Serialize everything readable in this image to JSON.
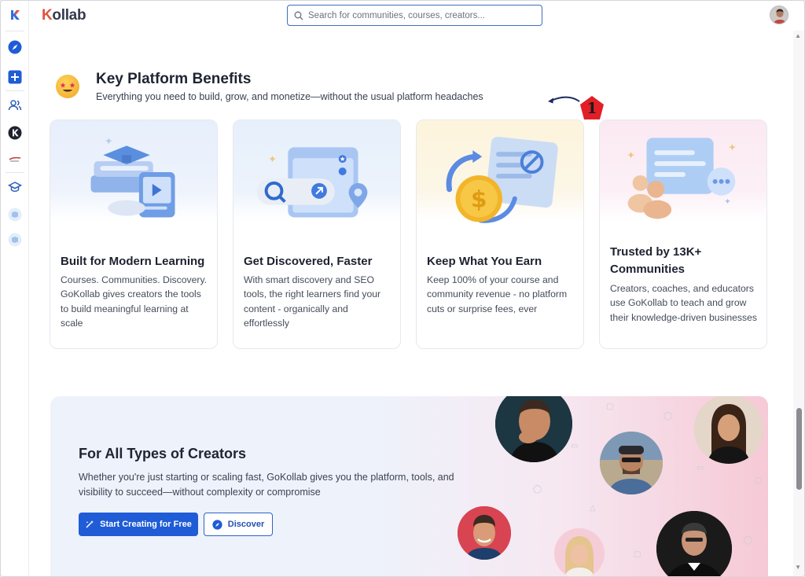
{
  "app": {
    "logo_text": "ollab",
    "logo_letter": "K"
  },
  "search": {
    "placeholder": "Search for communities, courses, creators..."
  },
  "sidebar": {
    "items": [
      {
        "name": "home-logo",
        "icon": "kollab-k-icon"
      },
      {
        "name": "discover",
        "icon": "compass-icon"
      },
      {
        "name": "create",
        "icon": "plus-square-icon"
      },
      {
        "name": "communities",
        "icon": "users-icon"
      },
      {
        "name": "kollab-community",
        "icon": "k-avatar-icon"
      },
      {
        "name": "community-2",
        "icon": "community-logo-icon"
      },
      {
        "name": "courses",
        "icon": "graduation-cap-icon"
      },
      {
        "name": "course-1",
        "icon": "course-badge-icon"
      },
      {
        "name": "course-2",
        "icon": "course-badge-icon"
      }
    ]
  },
  "benefits": {
    "title": "Key Platform Benefits",
    "subtitle": "Everything you need to build, grow, and monetize—without the usual platform headaches",
    "annotation_badge": "1",
    "cards": [
      {
        "title": "Built for Modern Learning",
        "body": "Courses. Communities. Discovery. GoKollab gives creators the tools to build meaningful learning at scale",
        "accent": "#e7effc"
      },
      {
        "title": "Get Discovered, Faster",
        "body": "With smart discovery and SEO tools, the right learners find your content - organically and effortlessly",
        "accent": "#e6f0fb"
      },
      {
        "title": "Keep What You Earn",
        "body": "Keep 100% of your course and community revenue - no platform cuts or surprise fees, ever",
        "accent": "#fdf4dc"
      },
      {
        "title": "Trusted by 13K+ Communities",
        "body": "Creators, coaches, and educators use GoKollab to teach and grow their knowledge-driven businesses",
        "accent": "#fbe9f2"
      }
    ]
  },
  "creators": {
    "title": "For All Types of Creators",
    "subtitle": "Whether you're just starting or scaling fast, GoKollab gives you the platform, tools, and visibility to succeed—without complexity or compromise",
    "primary_button": "Start Creating for Free",
    "secondary_button": "Discover"
  },
  "colors": {
    "brand_blue": "#1f5cd6",
    "annotation_red": "#e21f26"
  }
}
